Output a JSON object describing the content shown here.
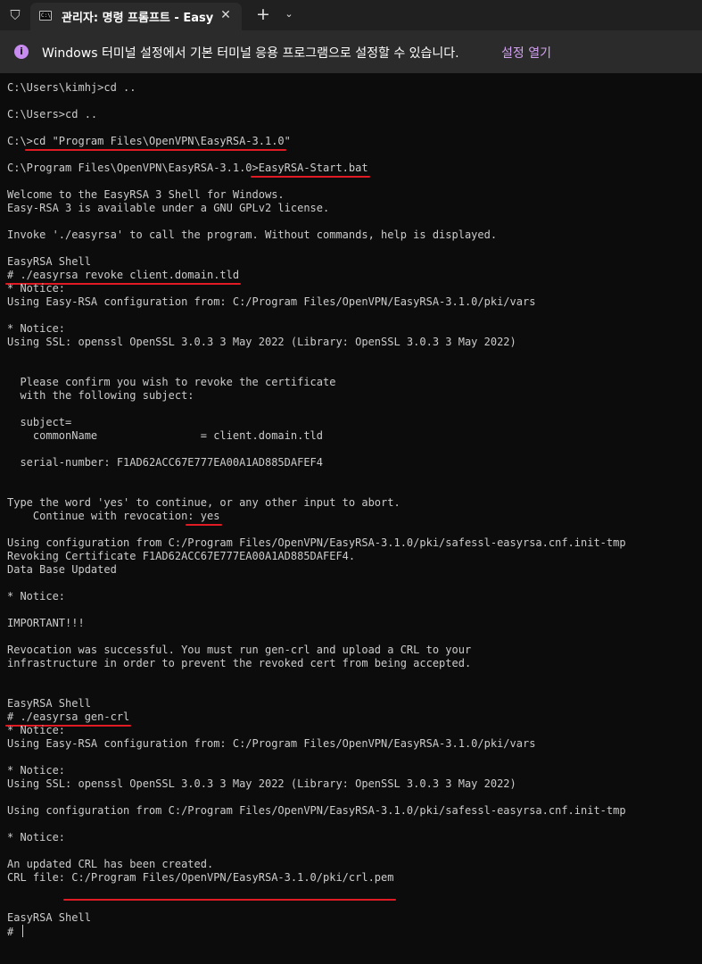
{
  "titlebar": {
    "tab_title": "관리자: 명령 프롬프트 - EasyRSA",
    "tab_icon_text": "C:\\",
    "close_glyph": "✕",
    "new_tab_glyph": "+",
    "dropdown_glyph": "⌄"
  },
  "infobar": {
    "icon_glyph": "i",
    "message": "Windows 터미널 설정에서 기본 터미널 응용 프로그램으로 설정할 수 있습니다.",
    "link": "설정 열기"
  },
  "terminal": {
    "lines": [
      "C:\\Users\\kimhj>cd ..",
      "",
      "C:\\Users>cd ..",
      "",
      "C:\\>cd \"Program Files\\OpenVPN\\EasyRSA-3.1.0\"",
      "",
      "C:\\Program Files\\OpenVPN\\EasyRSA-3.1.0>EasyRSA-Start.bat",
      "",
      "Welcome to the EasyRSA 3 Shell for Windows.",
      "Easy-RSA 3 is available under a GNU GPLv2 license.",
      "",
      "Invoke './easyrsa' to call the program. Without commands, help is displayed.",
      "",
      "EasyRSA Shell",
      "# ./easyrsa revoke client.domain.tld",
      "* Notice:",
      "Using Easy-RSA configuration from: C:/Program Files/OpenVPN/EasyRSA-3.1.0/pki/vars",
      "",
      "* Notice:",
      "Using SSL: openssl OpenSSL 3.0.3 3 May 2022 (Library: OpenSSL 3.0.3 3 May 2022)",
      "",
      "",
      "  Please confirm you wish to revoke the certificate",
      "  with the following subject:",
      "",
      "  subject=",
      "    commonName                = client.domain.tld",
      "",
      "  serial-number: F1AD62ACC67E777EA00A1AD885DAFEF4",
      "",
      "",
      "Type the word 'yes' to continue, or any other input to abort.",
      "    Continue with revocation: yes",
      "",
      "Using configuration from C:/Program Files/OpenVPN/EasyRSA-3.1.0/pki/safessl-easyrsa.cnf.init-tmp",
      "Revoking Certificate F1AD62ACC67E777EA00A1AD885DAFEF4.",
      "Data Base Updated",
      "",
      "* Notice:",
      "",
      "IMPORTANT!!!",
      "",
      "Revocation was successful. You must run gen-crl and upload a CRL to your",
      "infrastructure in order to prevent the revoked cert from being accepted.",
      "",
      "",
      "EasyRSA Shell",
      "# ./easyrsa gen-crl",
      "* Notice:",
      "Using Easy-RSA configuration from: C:/Program Files/OpenVPN/EasyRSA-3.1.0/pki/vars",
      "",
      "* Notice:",
      "Using SSL: openssl OpenSSL 3.0.3 3 May 2022 (Library: OpenSSL 3.0.3 3 May 2022)",
      "",
      "Using configuration from C:/Program Files/OpenVPN/EasyRSA-3.1.0/pki/safessl-easyrsa.cnf.init-tmp",
      "",
      "* Notice:",
      "",
      "An updated CRL has been created.",
      "CRL file: C:/Program Files/OpenVPN/EasyRSA-3.1.0/pki/crl.pem",
      "",
      "",
      "EasyRSA Shell",
      "# "
    ]
  }
}
